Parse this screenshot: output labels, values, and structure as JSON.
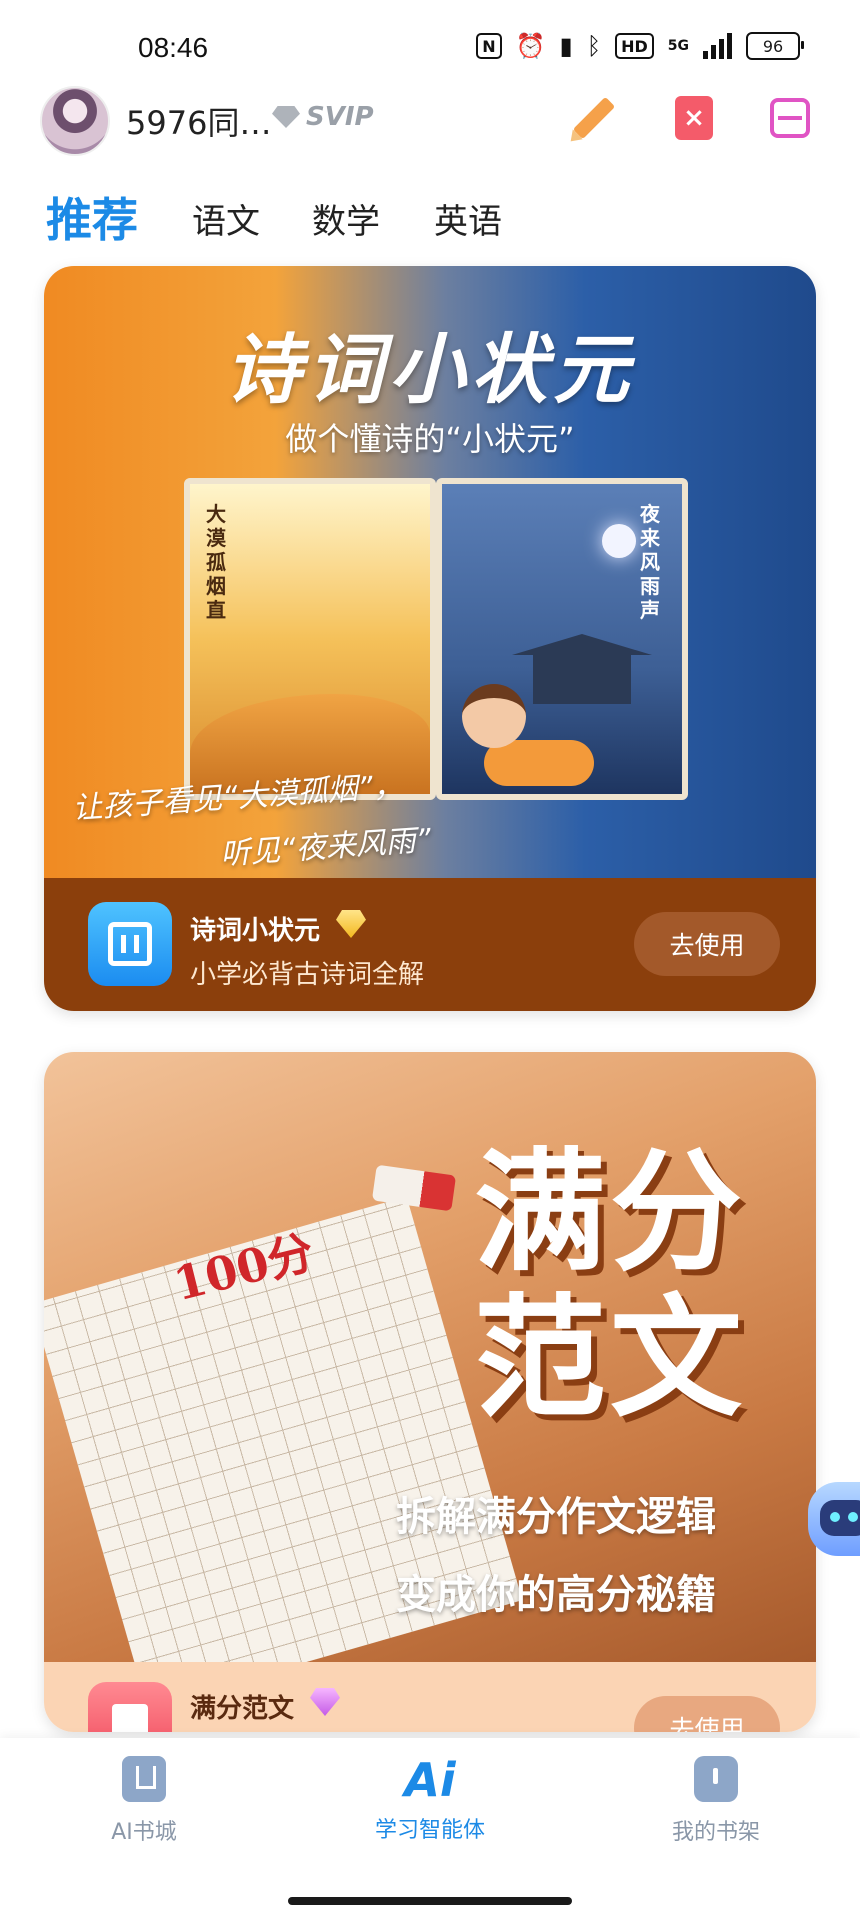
{
  "status_bar": {
    "time": "08:46",
    "network": "5G",
    "hd": "HD",
    "battery": "96"
  },
  "header": {
    "username": "5976同…",
    "badge": "SVIP",
    "icons": [
      "pencil-icon",
      "delete-doc-icon",
      "scan-icon"
    ]
  },
  "tabs": [
    {
      "label": "推荐",
      "active": true
    },
    {
      "label": "语文",
      "active": false
    },
    {
      "label": "数学",
      "active": false
    },
    {
      "label": "英语",
      "active": false
    }
  ],
  "cards": [
    {
      "banner": {
        "title": "诗词小状元",
        "subtitle": "做个懂诗的“小状元”",
        "book_left": "大漠孤烟直",
        "book_right": "夜来风雨声",
        "caption_1": "让孩子看见“大漠孤烟”，",
        "caption_2": "听见“夜来风雨”"
      },
      "app_name": "诗词小状元",
      "desc": "小学必背古诗词全解",
      "button": "去使用",
      "footer_color": "#8b3f0c"
    },
    {
      "banner": {
        "score": "100分",
        "big_1": "满分",
        "big_2": "范文",
        "line_1": "拆解满分作文逻辑",
        "line_2": "变成你的高分秘籍"
      },
      "app_name": "满分范文",
      "button": "去使用",
      "footer_color": "#fbd4b4"
    }
  ],
  "bottom_nav": [
    {
      "label": "AI书城",
      "icon": "book-icon",
      "active": false
    },
    {
      "label": "学习智能体",
      "icon_text": "Ai",
      "active": true
    },
    {
      "label": "我的书架",
      "icon": "bookshelf-icon",
      "active": false
    }
  ],
  "colors": {
    "accent": "#1c8ae6",
    "inactive": "#8a97a8"
  }
}
